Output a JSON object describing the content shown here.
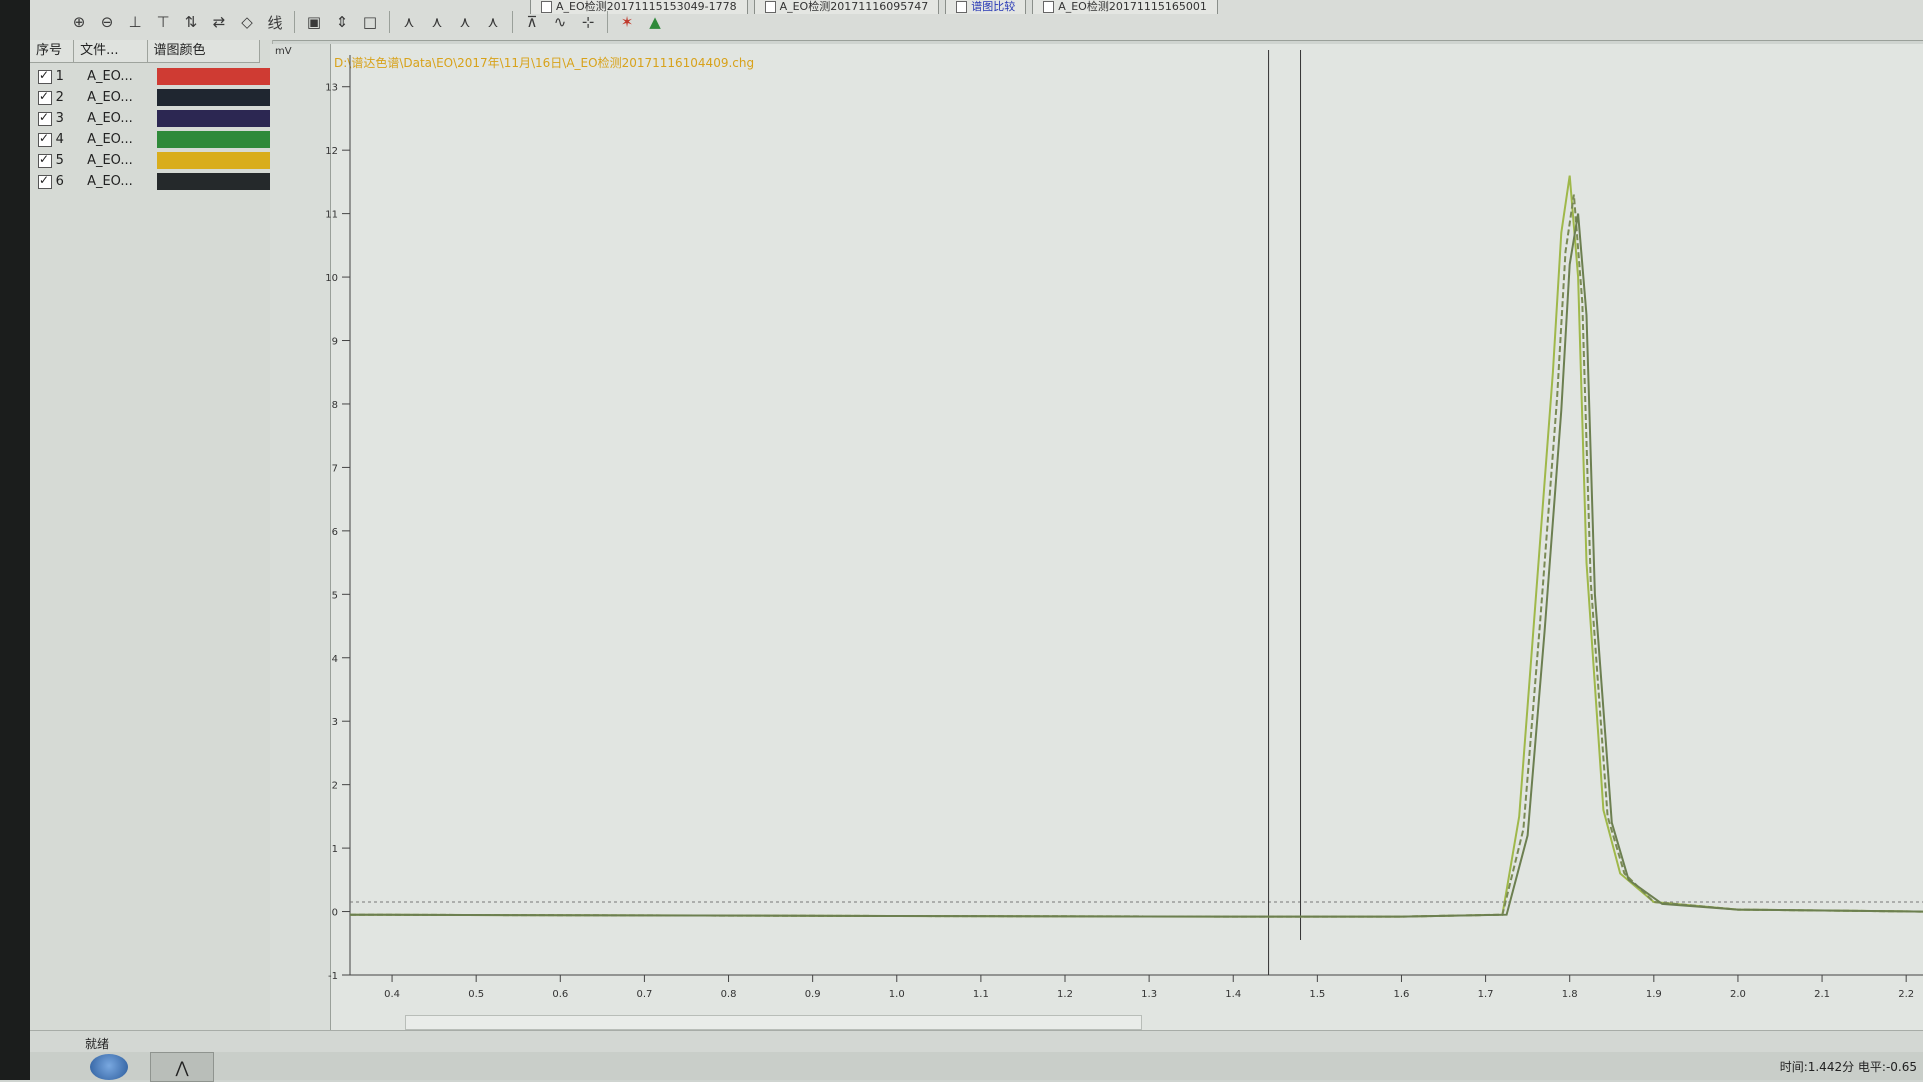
{
  "tabs": [
    {
      "label": "A_EO检测20171115153049-1778",
      "active": false
    },
    {
      "label": "A_EO检测20171116095747",
      "active": false
    },
    {
      "label": "谱图比较",
      "active": true
    },
    {
      "label": "A_EO检测20171115165001",
      "active": false
    }
  ],
  "toolbar": {
    "icons": [
      "zoom-in-icon",
      "zoom-out-icon",
      "baseline-up-icon",
      "baseline-down-icon",
      "compare-icon",
      "swap-icon",
      "diamond-icon",
      "line-icon",
      "select-box-icon",
      "expand-icon",
      "frame-icon",
      "peak-a-icon",
      "peak-b-icon",
      "peak-c-icon",
      "peak-d-icon",
      "marker-icon",
      "wave-icon",
      "split-icon",
      "color-icon",
      "green-peak-icon"
    ],
    "line_label": "线"
  },
  "legend": {
    "header_seq": "序号",
    "header_file": "文件...",
    "header_color": "谱图颜色",
    "rows": [
      {
        "num": "1",
        "file": "A_EO...",
        "color": "#cf3b33"
      },
      {
        "num": "2",
        "file": "A_EO...",
        "color": "#1f2630"
      },
      {
        "num": "3",
        "file": "A_EO...",
        "color": "#2c2752"
      },
      {
        "num": "4",
        "file": "A_EO...",
        "color": "#2f8a3a"
      },
      {
        "num": "5",
        "file": "A_EO...",
        "color": "#d9ad1c"
      },
      {
        "num": "6",
        "file": "A_EO...",
        "color": "#25292b"
      }
    ]
  },
  "chart": {
    "file_path": "D:\\谱达色谱\\Data\\EO\\2017年\\11月\\16日\\A_EO检测20171116104409.chg",
    "y_unit": "mV"
  },
  "chart_data": {
    "type": "line",
    "title": "",
    "xlabel": "",
    "ylabel": "mV",
    "xlim": [
      0.35,
      2.22
    ],
    "ylim": [
      -1,
      13.5
    ],
    "x_ticks": [
      "0.4",
      "0.5",
      "0.6",
      "0.7",
      "0.8",
      "0.9",
      "1.0",
      "1.1",
      "1.2",
      "1.3",
      "1.4",
      "1.5",
      "1.6",
      "1.7",
      "1.8",
      "1.9",
      "2.0",
      "2.1",
      "2.2"
    ],
    "y_ticks": [
      "-1",
      "0",
      "1",
      "2",
      "3",
      "4",
      "5",
      "6",
      "7",
      "8",
      "9",
      "10",
      "11",
      "12",
      "13"
    ],
    "cursor_x": 1.442,
    "series": [
      {
        "color": "#9fb84a",
        "x": [
          0.35,
          1.0,
          1.4,
          1.6,
          1.72,
          1.74,
          1.76,
          1.78,
          1.79,
          1.8,
          1.81,
          1.82,
          1.84,
          1.86,
          1.9,
          2.0,
          2.22
        ],
        "y": [
          -0.05,
          -0.07,
          -0.08,
          -0.08,
          -0.05,
          1.5,
          5.0,
          8.5,
          10.7,
          11.6,
          10.0,
          5.5,
          1.6,
          0.6,
          0.15,
          0.03,
          0.0
        ]
      },
      {
        "color": "#7a8a55",
        "x": [
          0.35,
          1.0,
          1.4,
          1.6,
          1.72,
          1.745,
          1.765,
          1.785,
          1.795,
          1.805,
          1.815,
          1.825,
          1.845,
          1.865,
          1.9,
          2.0,
          2.22
        ],
        "y": [
          -0.05,
          -0.07,
          -0.08,
          -0.08,
          -0.05,
          1.3,
          4.6,
          8.1,
          10.4,
          11.3,
          9.6,
          5.2,
          1.5,
          0.6,
          0.15,
          0.03,
          0.0
        ]
      },
      {
        "color": "#6c7f50",
        "x": [
          0.35,
          1.0,
          1.4,
          1.6,
          1.725,
          1.75,
          1.77,
          1.79,
          1.8,
          1.81,
          1.82,
          1.83,
          1.85,
          1.87,
          1.91,
          2.0,
          2.22
        ],
        "y": [
          -0.05,
          -0.07,
          -0.08,
          -0.08,
          -0.05,
          1.2,
          4.4,
          7.9,
          10.2,
          11.0,
          9.4,
          5.0,
          1.4,
          0.5,
          0.12,
          0.03,
          0.0
        ]
      }
    ],
    "grid": false,
    "legend_position": "left-panel"
  },
  "status": {
    "left_text": "就绪",
    "readout": "时间:1.442分  电平:-0.65"
  }
}
